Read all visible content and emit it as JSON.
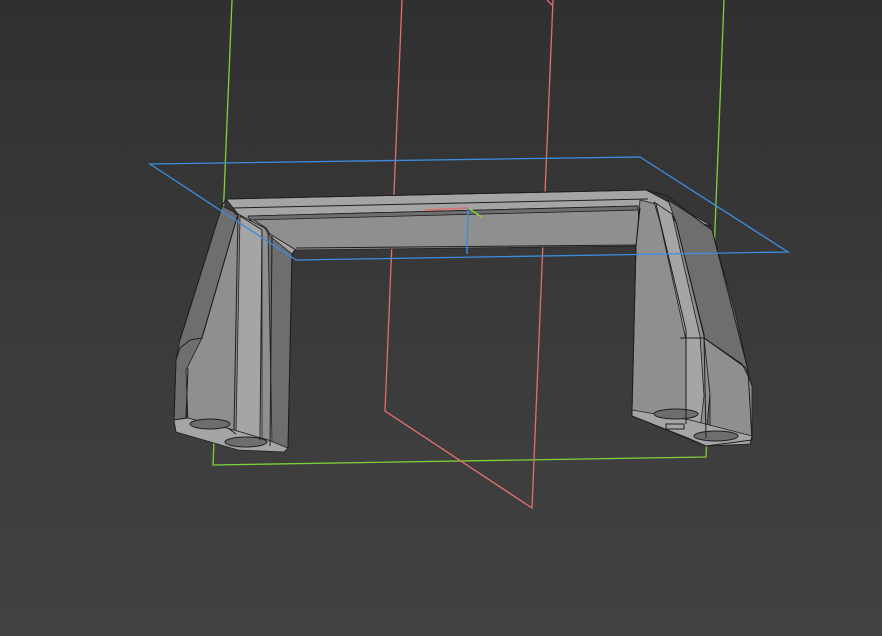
{
  "viewport": {
    "background_top": "#303030",
    "background_bottom": "#424242"
  },
  "model": {
    "name": "u-shaped-handle-bracket",
    "face_color": "#8f8f8f",
    "face_light": "#a5a5a5",
    "face_dark": "#6e6e6e",
    "edge_color": "#1e1e1e"
  },
  "planes": [
    {
      "name": "xy-plane",
      "color": "#3d8ce0"
    },
    {
      "name": "yz-plane",
      "color": "#e07070"
    },
    {
      "name": "xz-plane",
      "color": "#7fd13a"
    }
  ],
  "origin_axes": {
    "x_color": "#e07070",
    "y_color": "#7fd13a",
    "z_color": "#3d8ce0"
  }
}
